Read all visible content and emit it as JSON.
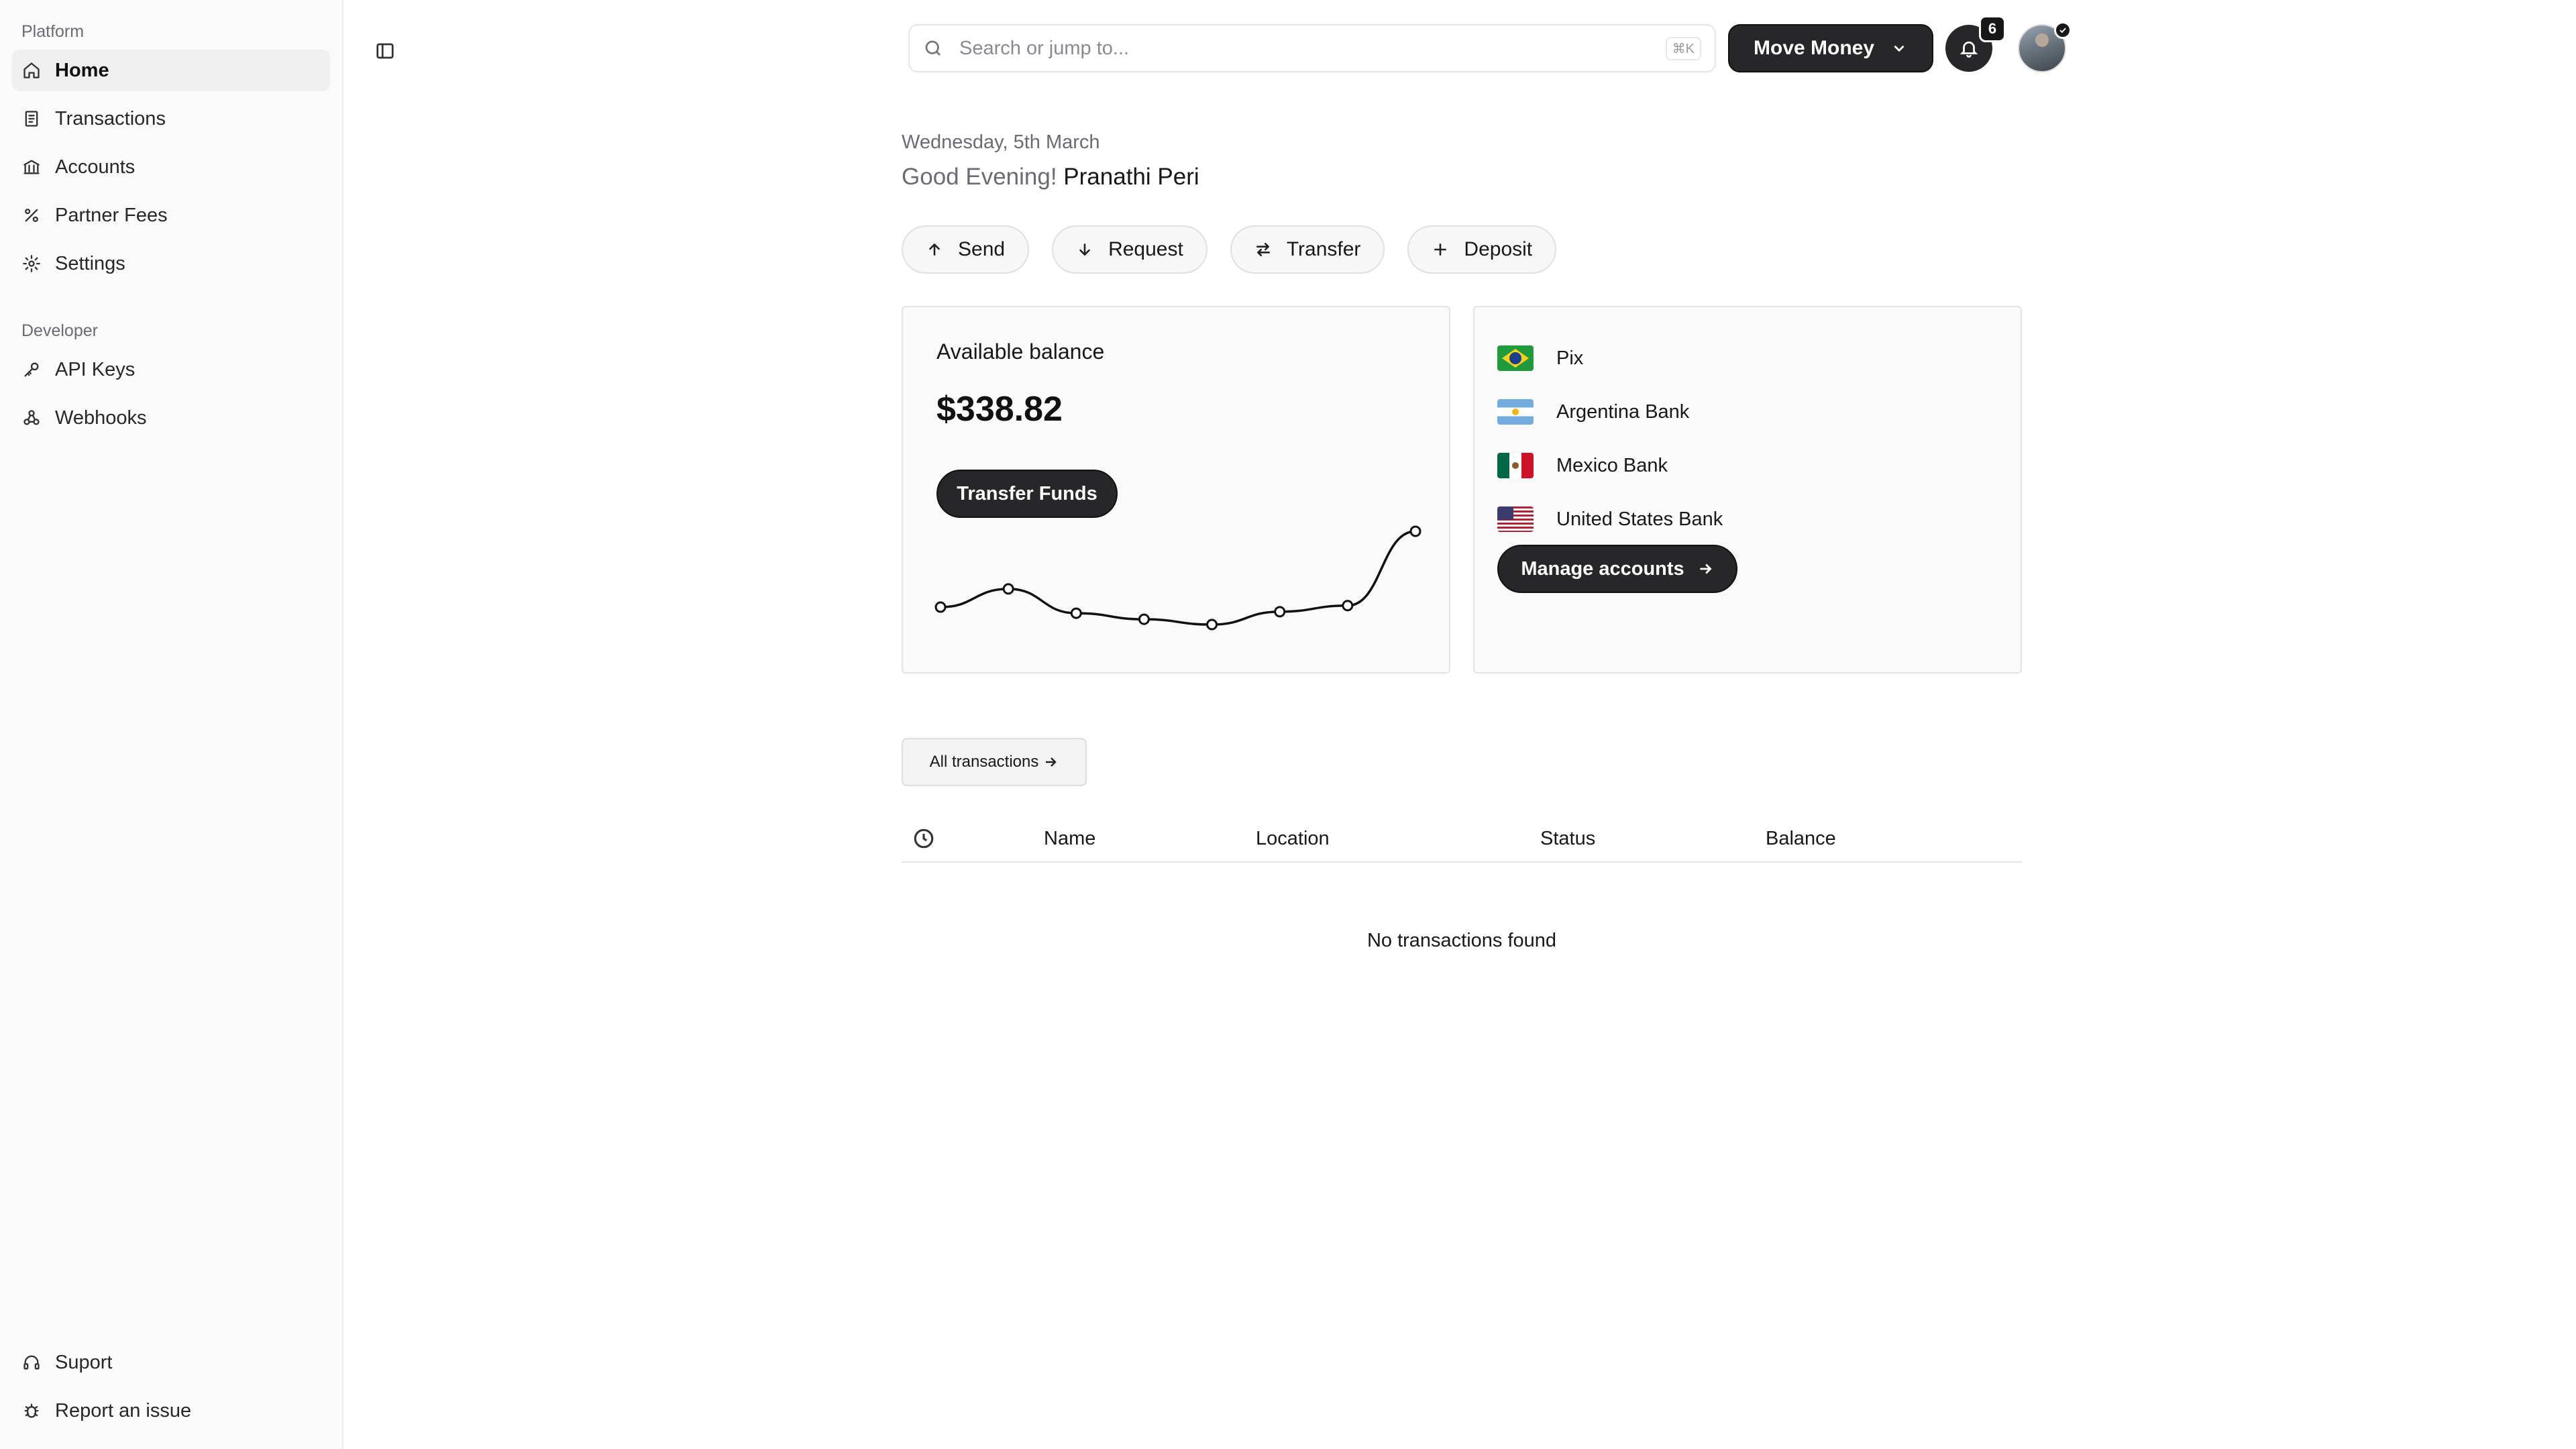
{
  "sidebar": {
    "platform_label": "Platform",
    "platform_items": [
      {
        "label": "Home",
        "icon": "home-icon",
        "active": true
      },
      {
        "label": "Transactions",
        "icon": "receipt-icon"
      },
      {
        "label": "Accounts",
        "icon": "bank-icon"
      },
      {
        "label": "Partner Fees",
        "icon": "percent-icon"
      },
      {
        "label": "Settings",
        "icon": "gear-icon"
      }
    ],
    "developer_label": "Developer",
    "developer_items": [
      {
        "label": "API Keys",
        "icon": "key-icon"
      },
      {
        "label": "Webhooks",
        "icon": "webhook-icon"
      }
    ],
    "bottom_items": [
      {
        "label": "Suport",
        "icon": "headset-icon"
      },
      {
        "label": "Report an issue",
        "icon": "bug-icon"
      }
    ]
  },
  "topbar": {
    "search_placeholder": "Search or jump to...",
    "search_shortcut": "⌘K",
    "move_money_label": "Move Money",
    "notification_count": "6"
  },
  "greeting": {
    "date": "Wednesday, 5th March",
    "salutation": "Good Evening!",
    "name": "Pranathi Peri"
  },
  "actions": [
    {
      "label": "Send",
      "icon": "arrow-up-icon"
    },
    {
      "label": "Request",
      "icon": "arrow-down-icon"
    },
    {
      "label": "Transfer",
      "icon": "swap-icon"
    },
    {
      "label": "Deposit",
      "icon": "plus-icon"
    }
  ],
  "balance_card": {
    "label": "Available balance",
    "value": "$338.82",
    "button_label": "Transfer Funds"
  },
  "chart_data": {
    "type": "line",
    "title": "",
    "series": [
      {
        "values": [
          38,
          62,
          30,
          22,
          15,
          32,
          40,
          138
        ]
      }
    ]
  },
  "accounts_card": {
    "accounts": [
      {
        "name": "Pix",
        "flag": "br"
      },
      {
        "name": "Argentina Bank",
        "flag": "ar"
      },
      {
        "name": "Mexico Bank",
        "flag": "mx"
      },
      {
        "name": "United States Bank",
        "flag": "us"
      }
    ],
    "button_label": "Manage accounts"
  },
  "transactions": {
    "all_label": "All transactions",
    "columns": [
      "Name",
      "Location",
      "Status",
      "Balance"
    ],
    "empty_message": "No transactions found"
  },
  "colors": {
    "primary_button": "#27272a",
    "sidebar_bg": "#fafafa",
    "card_bg": "#fafafa"
  }
}
